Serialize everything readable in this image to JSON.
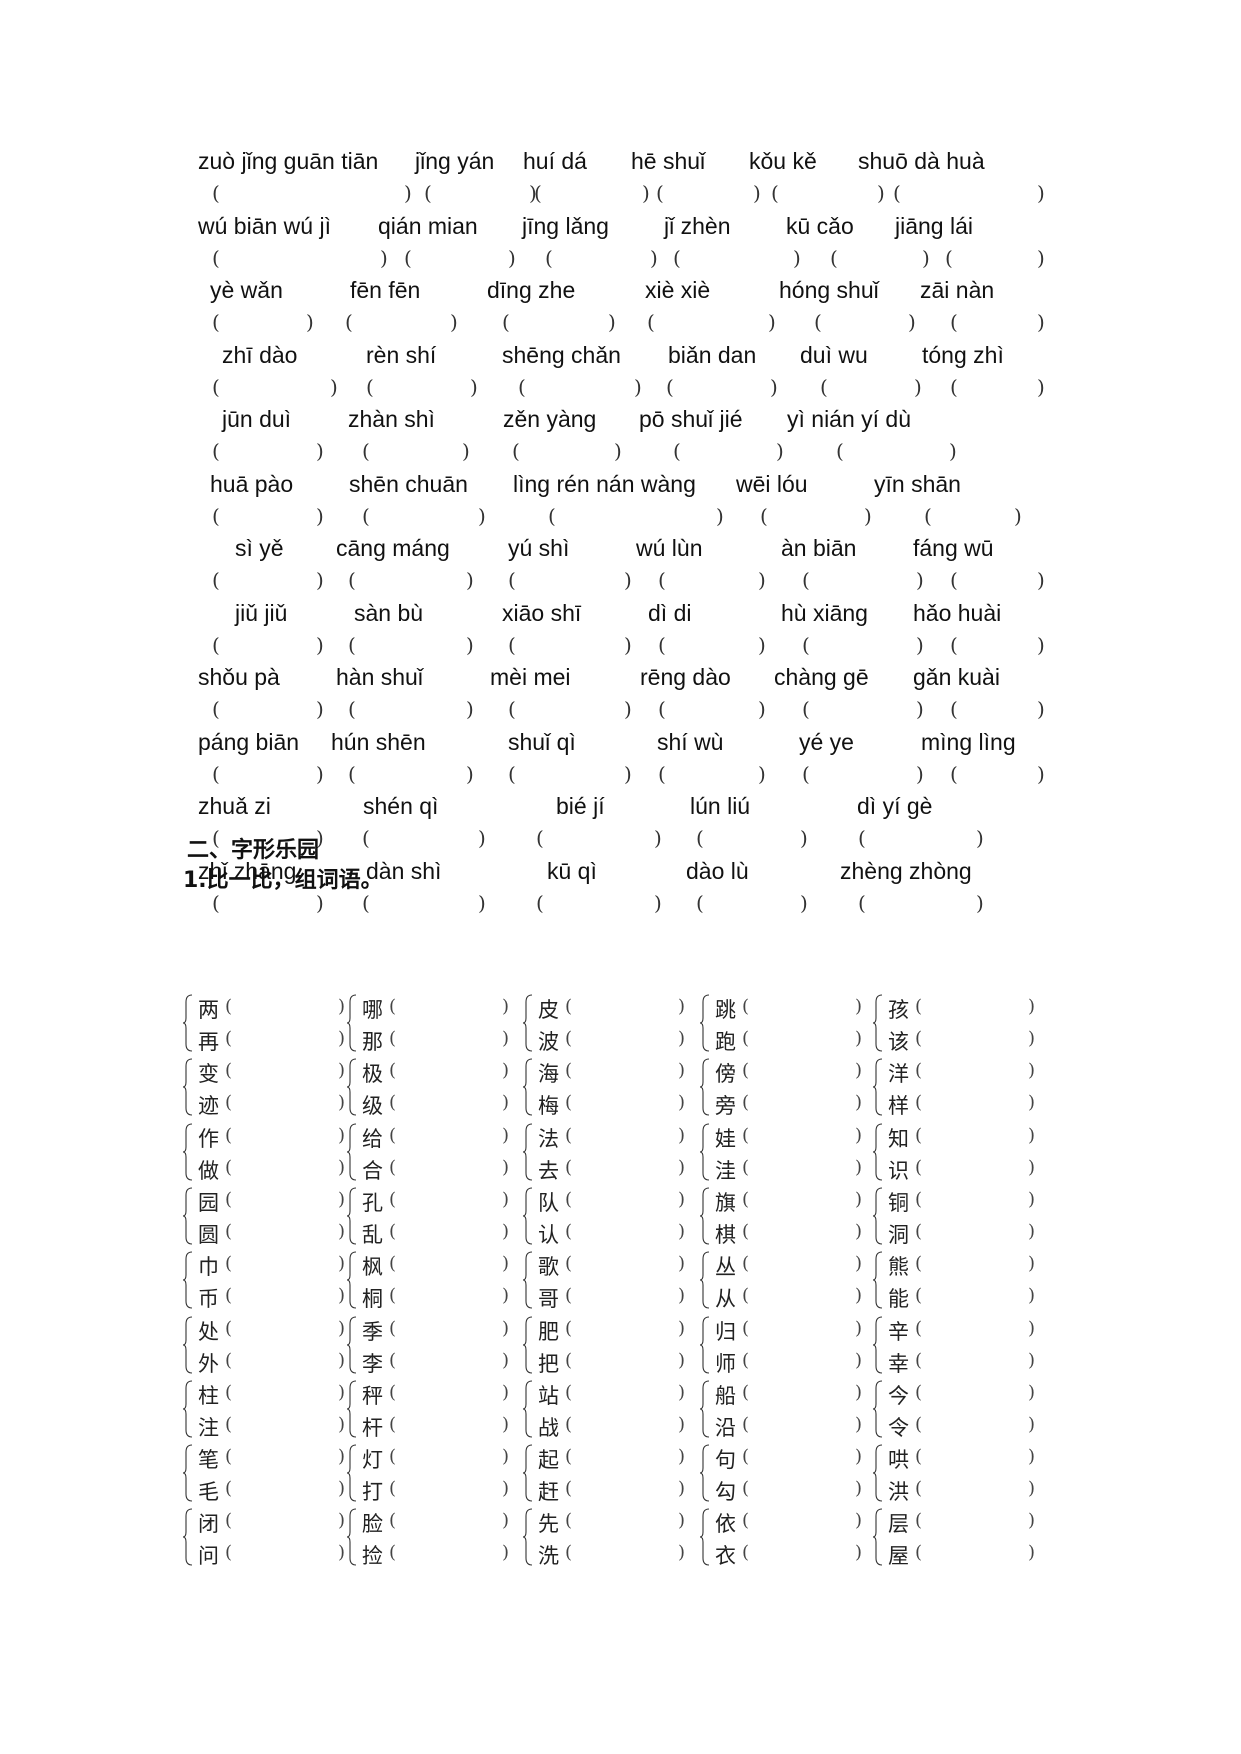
{
  "section1": {
    "rows": [
      [
        "zuò jǐng guān tiān",
        "jǐng yán",
        "huí dá",
        "hē shuǐ",
        "kǒu kě",
        "shuō dà huà"
      ],
      [
        "wú biān wú jì",
        "qián mian",
        "jīng lǎng",
        "jǐ zhèn",
        "kū cǎo",
        "jiāng lái"
      ],
      [
        "yè wǎn",
        "fēn fēn",
        "dīng zhe",
        "xiè xiè",
        "hóng shuǐ",
        "zāi nàn"
      ],
      [
        "zhī dào",
        "rèn shí",
        "shēng chǎn",
        "biǎn dan",
        "duì wu",
        "tóng zhì"
      ],
      [
        "jūn duì",
        "zhàn shì",
        "zěn yàng",
        "pō shuǐ jié",
        "yì nián yí dù"
      ],
      [
        "huā pào",
        "shēn chuān",
        "lìng rén nán wàng",
        "wēi lóu",
        "yīn shān"
      ],
      [
        "sì yě",
        "cāng máng",
        "yú shì",
        "wú lùn",
        "àn biān",
        "fáng wū"
      ],
      [
        "jiǔ jiǔ",
        "sàn bù",
        "xiāo shī",
        "dì di",
        "hù xiāng",
        "hǎo huài"
      ],
      [
        "shǒu pà",
        "hàn shuǐ",
        "mèi mei",
        "rēng dào",
        "chàng gē",
        "gǎn kuài"
      ],
      [
        "páng biān",
        "hún shēn",
        "shuǐ qì",
        "shí wù",
        "yé ye",
        "mìng lìng"
      ],
      [
        "zhuǎ zi",
        "shén qì",
        "bié jí",
        "lún liú",
        "dì yí gè"
      ],
      [
        "zhǐ zhāng",
        "dàn shì",
        "kū qì",
        "dào lù",
        "zhèng zhòng"
      ]
    ],
    "open_paren": "(",
    "close_paren": ")"
  },
  "section2": {
    "title": "二、字形乐园",
    "subtitle": "1.比一比，组词语。",
    "groups": [
      [
        [
          "两",
          "再"
        ],
        [
          "哪",
          "那"
        ],
        [
          "皮",
          "波"
        ],
        [
          "跳",
          "跑"
        ],
        [
          "孩",
          "该"
        ]
      ],
      [
        [
          "变",
          "迹"
        ],
        [
          "极",
          "级"
        ],
        [
          "海",
          "梅"
        ],
        [
          "傍",
          "旁"
        ],
        [
          "洋",
          "样"
        ]
      ],
      [
        [
          "作",
          "做"
        ],
        [
          "给",
          "合"
        ],
        [
          "法",
          "去"
        ],
        [
          "娃",
          "洼"
        ],
        [
          "知",
          "识"
        ]
      ],
      [
        [
          "园",
          "圆"
        ],
        [
          "孔",
          "乱"
        ],
        [
          "队",
          "认"
        ],
        [
          "旗",
          "棋"
        ],
        [
          "铜",
          "洞"
        ]
      ],
      [
        [
          "巾",
          "币"
        ],
        [
          "枫",
          "桐"
        ],
        [
          "歌",
          "哥"
        ],
        [
          "丛",
          "从"
        ],
        [
          "熊",
          "能"
        ]
      ],
      [
        [
          "处",
          "外"
        ],
        [
          "季",
          "李"
        ],
        [
          "肥",
          "把"
        ],
        [
          "归",
          "师"
        ],
        [
          "辛",
          "幸"
        ]
      ],
      [
        [
          "柱",
          "注"
        ],
        [
          "秤",
          "杆"
        ],
        [
          "站",
          "战"
        ],
        [
          "船",
          "沿"
        ],
        [
          "今",
          "令"
        ]
      ],
      [
        [
          "笔",
          "毛"
        ],
        [
          "灯",
          "打"
        ],
        [
          "起",
          "赶"
        ],
        [
          "句",
          "勾"
        ],
        [
          "哄",
          "洪"
        ]
      ],
      [
        [
          "闭",
          "问"
        ],
        [
          "脸",
          "捡"
        ],
        [
          "先",
          "洗"
        ],
        [
          "依",
          "衣"
        ],
        [
          "层",
          "屋"
        ]
      ]
    ]
  }
}
